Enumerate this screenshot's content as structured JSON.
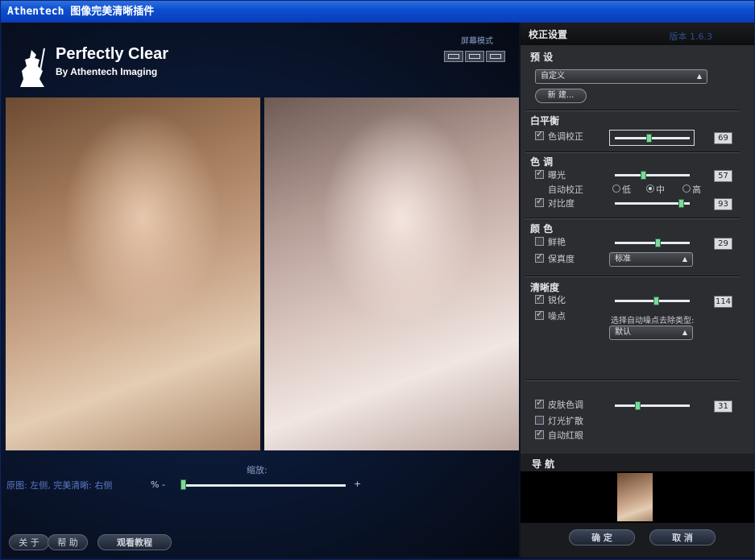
{
  "window": {
    "title": "Athentech 图像完美清晰插件"
  },
  "logo": {
    "title": "Perfectly Clear",
    "subtitle": "By Athentech Imaging"
  },
  "screen_mode": {
    "label": "屏幕模式"
  },
  "preview": {
    "zoom_label": "缩放:",
    "caption": "原图: 左侧, 完美清晰: 右侧",
    "zoom_minus": "% -",
    "zoom_plus": "+",
    "zoom_level": 0.0
  },
  "bottom_buttons": {
    "about": "关 于",
    "help": "帮 助",
    "tutorial": "观看教程"
  },
  "panel": {
    "title": "校正设置",
    "version": "版本 1.6.3",
    "presets": {
      "heading": "预 设",
      "selected": "自定义",
      "new_button": "新  建..."
    },
    "white_balance": {
      "heading": "白平衡",
      "tint": {
        "label": "色调校正",
        "checked": true,
        "value": "69"
      }
    },
    "tone": {
      "heading": "色 调",
      "exposure": {
        "label": "曝光",
        "checked": true,
        "value": "57"
      },
      "auto_correct": {
        "label": "自动校正",
        "options": [
          "低",
          "中",
          "高"
        ],
        "selected": "中"
      },
      "contrast": {
        "label": "对比度",
        "checked": true,
        "value": "93"
      }
    },
    "color": {
      "heading": "颜 色",
      "vibrance": {
        "label": "鲜艳",
        "checked": false,
        "value": "29"
      },
      "fidelity": {
        "label": "保真度",
        "checked": true,
        "selected": "标准"
      }
    },
    "sharpness": {
      "heading": "清晰度",
      "sharpen": {
        "label": "锐化",
        "checked": true,
        "value": "114"
      },
      "noise": {
        "label": "噪点",
        "checked": true,
        "type_label": "选择自动噪点去除类型:",
        "selected": "默认"
      }
    },
    "skin": {
      "skin_tone": {
        "label": "皮肤色调",
        "checked": true,
        "value": "31"
      },
      "light_diffusion": {
        "label": "灯光扩散",
        "checked": false
      },
      "red_eye": {
        "label": "自动红眼",
        "checked": true
      }
    },
    "navigation": {
      "heading": "导 航"
    },
    "ok": "确  定",
    "cancel": "取  消"
  },
  "colors": {
    "accent": "#7dd99a",
    "titlebar": "#0a4fd0",
    "panel": "#2b2d31"
  }
}
